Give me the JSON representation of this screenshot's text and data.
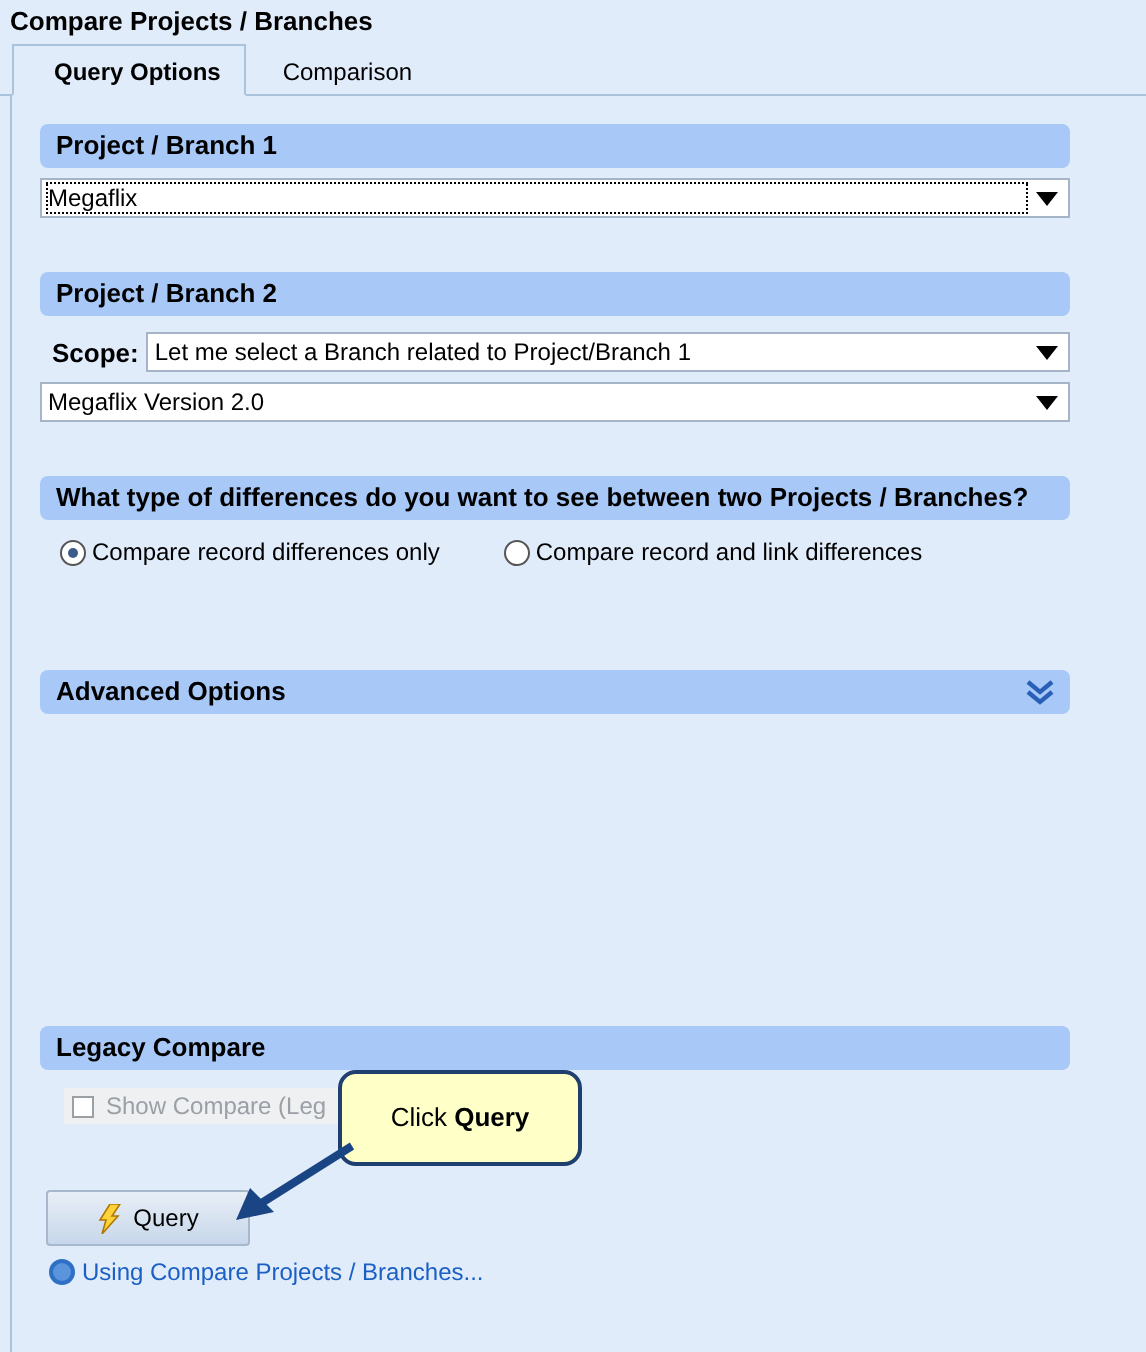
{
  "window": {
    "title": "Compare Projects / Branches"
  },
  "tabs": [
    {
      "label": "Query Options",
      "selected": true
    },
    {
      "label": "Comparison",
      "selected": false
    }
  ],
  "project_branch_1": {
    "heading": "Project / Branch 1",
    "value": "Megaflix",
    "focused": true
  },
  "project_branch_2": {
    "heading": "Project / Branch 2",
    "scope_label": "Scope:",
    "scope_value": "Let me select a Branch related to Project/Branch 1",
    "value": "Megaflix Version 2.0"
  },
  "differences": {
    "heading": "What type of differences do you want to see between two Projects / Branches?",
    "options": [
      {
        "label": "Compare record differences only",
        "selected": true
      },
      {
        "label": "Compare record and link differences",
        "selected": false
      }
    ]
  },
  "advanced_options": {
    "heading": "Advanced Options",
    "expanded": false
  },
  "legacy_compare": {
    "heading": "Legacy Compare",
    "checkbox": {
      "label": "Show Compare (Leg",
      "checked": false,
      "disabled": true
    }
  },
  "query_button": "Query",
  "help_link": "Using Compare Projects / Branches...",
  "callout": {
    "text": "Click **Query**"
  }
}
